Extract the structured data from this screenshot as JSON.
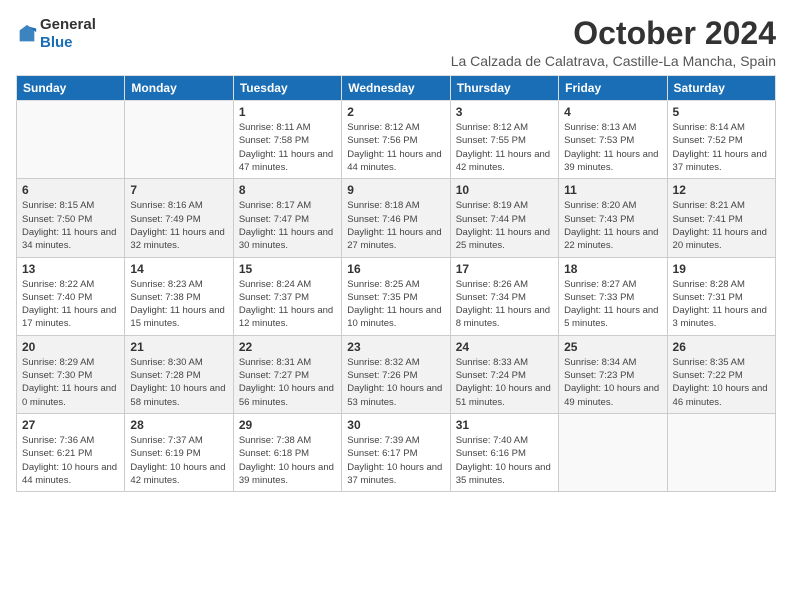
{
  "header": {
    "logo": {
      "general": "General",
      "blue": "Blue"
    },
    "title": "October 2024",
    "location": "La Calzada de Calatrava, Castille-La Mancha, Spain"
  },
  "weekdays": [
    "Sunday",
    "Monday",
    "Tuesday",
    "Wednesday",
    "Thursday",
    "Friday",
    "Saturday"
  ],
  "weeks": [
    [
      {
        "day": "",
        "info": ""
      },
      {
        "day": "",
        "info": ""
      },
      {
        "day": "1",
        "info": "Sunrise: 8:11 AM\nSunset: 7:58 PM\nDaylight: 11 hours and 47 minutes."
      },
      {
        "day": "2",
        "info": "Sunrise: 8:12 AM\nSunset: 7:56 PM\nDaylight: 11 hours and 44 minutes."
      },
      {
        "day": "3",
        "info": "Sunrise: 8:12 AM\nSunset: 7:55 PM\nDaylight: 11 hours and 42 minutes."
      },
      {
        "day": "4",
        "info": "Sunrise: 8:13 AM\nSunset: 7:53 PM\nDaylight: 11 hours and 39 minutes."
      },
      {
        "day": "5",
        "info": "Sunrise: 8:14 AM\nSunset: 7:52 PM\nDaylight: 11 hours and 37 minutes."
      }
    ],
    [
      {
        "day": "6",
        "info": "Sunrise: 8:15 AM\nSunset: 7:50 PM\nDaylight: 11 hours and 34 minutes."
      },
      {
        "day": "7",
        "info": "Sunrise: 8:16 AM\nSunset: 7:49 PM\nDaylight: 11 hours and 32 minutes."
      },
      {
        "day": "8",
        "info": "Sunrise: 8:17 AM\nSunset: 7:47 PM\nDaylight: 11 hours and 30 minutes."
      },
      {
        "day": "9",
        "info": "Sunrise: 8:18 AM\nSunset: 7:46 PM\nDaylight: 11 hours and 27 minutes."
      },
      {
        "day": "10",
        "info": "Sunrise: 8:19 AM\nSunset: 7:44 PM\nDaylight: 11 hours and 25 minutes."
      },
      {
        "day": "11",
        "info": "Sunrise: 8:20 AM\nSunset: 7:43 PM\nDaylight: 11 hours and 22 minutes."
      },
      {
        "day": "12",
        "info": "Sunrise: 8:21 AM\nSunset: 7:41 PM\nDaylight: 11 hours and 20 minutes."
      }
    ],
    [
      {
        "day": "13",
        "info": "Sunrise: 8:22 AM\nSunset: 7:40 PM\nDaylight: 11 hours and 17 minutes."
      },
      {
        "day": "14",
        "info": "Sunrise: 8:23 AM\nSunset: 7:38 PM\nDaylight: 11 hours and 15 minutes."
      },
      {
        "day": "15",
        "info": "Sunrise: 8:24 AM\nSunset: 7:37 PM\nDaylight: 11 hours and 12 minutes."
      },
      {
        "day": "16",
        "info": "Sunrise: 8:25 AM\nSunset: 7:35 PM\nDaylight: 11 hours and 10 minutes."
      },
      {
        "day": "17",
        "info": "Sunrise: 8:26 AM\nSunset: 7:34 PM\nDaylight: 11 hours and 8 minutes."
      },
      {
        "day": "18",
        "info": "Sunrise: 8:27 AM\nSunset: 7:33 PM\nDaylight: 11 hours and 5 minutes."
      },
      {
        "day": "19",
        "info": "Sunrise: 8:28 AM\nSunset: 7:31 PM\nDaylight: 11 hours and 3 minutes."
      }
    ],
    [
      {
        "day": "20",
        "info": "Sunrise: 8:29 AM\nSunset: 7:30 PM\nDaylight: 11 hours and 0 minutes."
      },
      {
        "day": "21",
        "info": "Sunrise: 8:30 AM\nSunset: 7:28 PM\nDaylight: 10 hours and 58 minutes."
      },
      {
        "day": "22",
        "info": "Sunrise: 8:31 AM\nSunset: 7:27 PM\nDaylight: 10 hours and 56 minutes."
      },
      {
        "day": "23",
        "info": "Sunrise: 8:32 AM\nSunset: 7:26 PM\nDaylight: 10 hours and 53 minutes."
      },
      {
        "day": "24",
        "info": "Sunrise: 8:33 AM\nSunset: 7:24 PM\nDaylight: 10 hours and 51 minutes."
      },
      {
        "day": "25",
        "info": "Sunrise: 8:34 AM\nSunset: 7:23 PM\nDaylight: 10 hours and 49 minutes."
      },
      {
        "day": "26",
        "info": "Sunrise: 8:35 AM\nSunset: 7:22 PM\nDaylight: 10 hours and 46 minutes."
      }
    ],
    [
      {
        "day": "27",
        "info": "Sunrise: 7:36 AM\nSunset: 6:21 PM\nDaylight: 10 hours and 44 minutes."
      },
      {
        "day": "28",
        "info": "Sunrise: 7:37 AM\nSunset: 6:19 PM\nDaylight: 10 hours and 42 minutes."
      },
      {
        "day": "29",
        "info": "Sunrise: 7:38 AM\nSunset: 6:18 PM\nDaylight: 10 hours and 39 minutes."
      },
      {
        "day": "30",
        "info": "Sunrise: 7:39 AM\nSunset: 6:17 PM\nDaylight: 10 hours and 37 minutes."
      },
      {
        "day": "31",
        "info": "Sunrise: 7:40 AM\nSunset: 6:16 PM\nDaylight: 10 hours and 35 minutes."
      },
      {
        "day": "",
        "info": ""
      },
      {
        "day": "",
        "info": ""
      }
    ]
  ]
}
